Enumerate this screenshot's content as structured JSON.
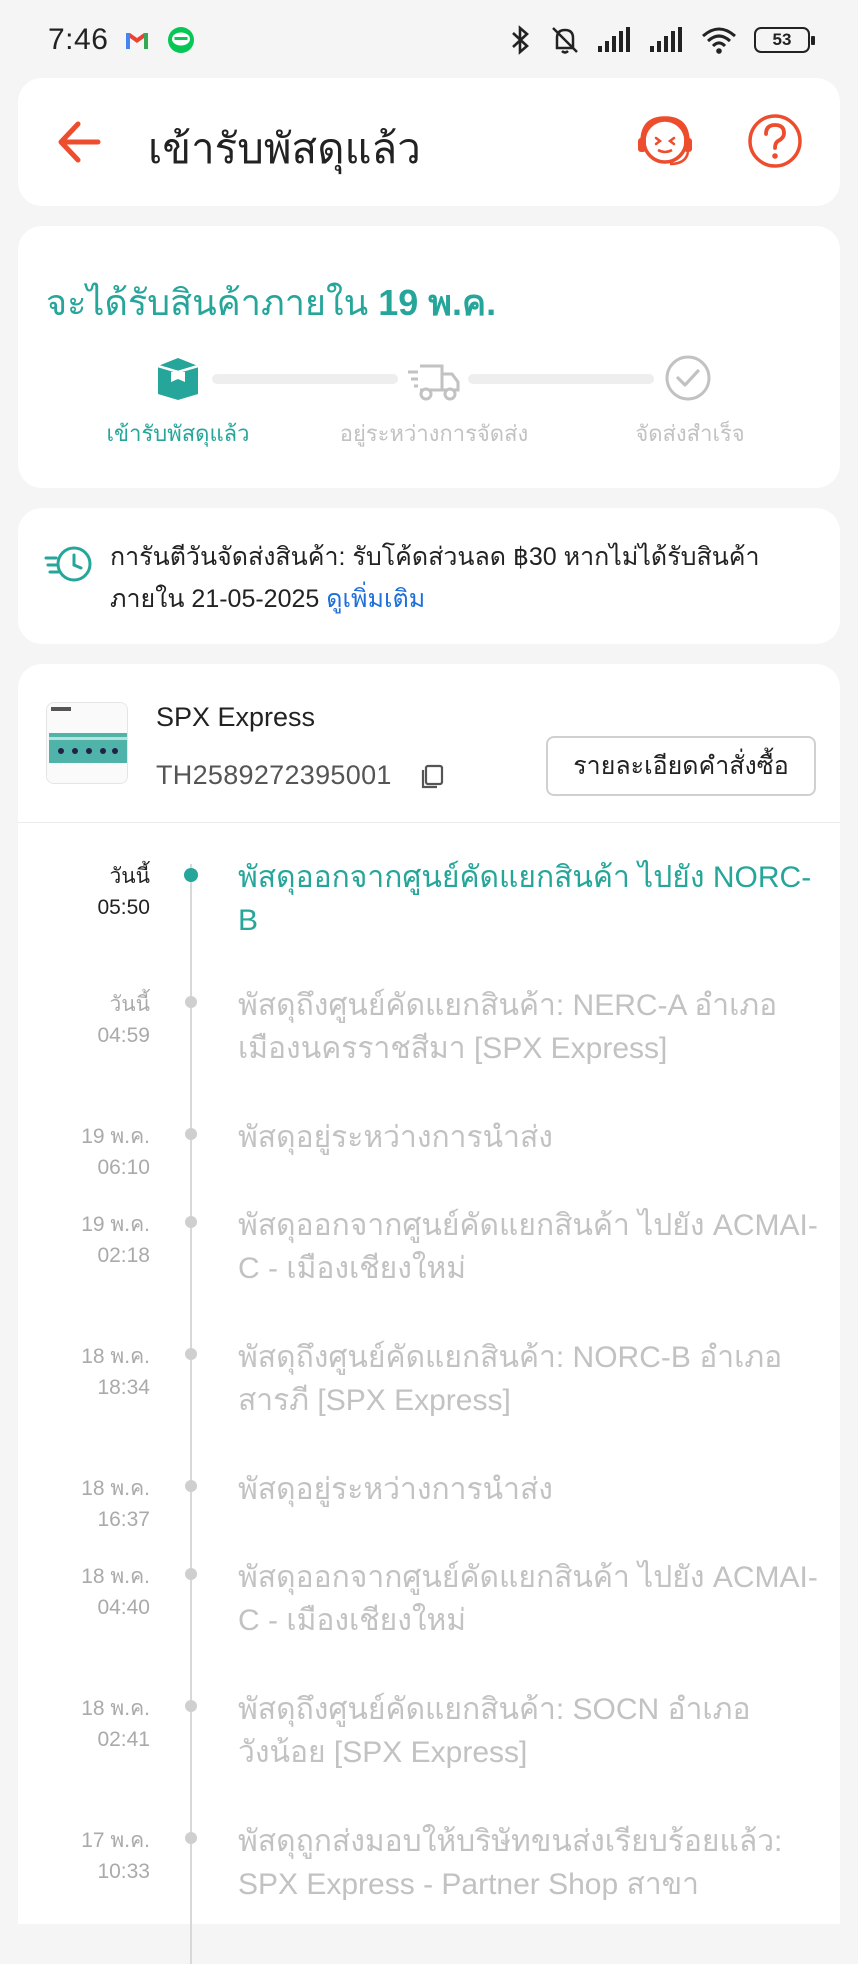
{
  "status_bar": {
    "time": "7:46",
    "battery": "53"
  },
  "header": {
    "title": "เข้ารับพัสดุแล้ว"
  },
  "eta": {
    "prefix": "จะได้รับสินค้าภายใน",
    "date": "19 พ.ค.",
    "steps": [
      {
        "label": "เข้ารับพัสดุแล้ว",
        "active": true
      },
      {
        "label": "อยู่ระหว่างการจัดส่ง",
        "active": false
      },
      {
        "label": "จัดส่งสำเร็จ",
        "active": false
      }
    ],
    "active_color": "#26a69a",
    "inactive_color": "#c2c2c2"
  },
  "guarantee": {
    "text": "การันตีวันจัดส่งสินค้า: รับโค้ดส่วนลด ฿30 หากไม่ได้รับสินค้าภายใน 21-05-2025",
    "link": "ดูเพิ่มเติม"
  },
  "shipment": {
    "carrier": "SPX Express",
    "tracking_number": "TH2589272395001",
    "order_detail_button": "รายละเอียดคำสั่งซื้อ"
  },
  "timeline": [
    {
      "date": "วันนี้",
      "time": "05:50",
      "description": "พัสดุออกจากศูนย์คัดแยกสินค้า ไปยัง NORC-B",
      "current": true
    },
    {
      "date": "วันนี้",
      "time": "04:59",
      "description": "พัสดุถึงศูนย์คัดแยกสินค้า: NERC-A อำเภอเมืองนครราชสีมา [SPX Express]",
      "current": false
    },
    {
      "date": "19 พ.ค.",
      "time": "06:10",
      "description": "พัสดุอยู่ระหว่างการนำส่ง",
      "current": false
    },
    {
      "date": "19 พ.ค.",
      "time": "02:18",
      "description": "พัสดุออกจากศูนย์คัดแยกสินค้า ไปยัง ACMAI-C - เมืองเชียงใหม่",
      "current": false
    },
    {
      "date": "18 พ.ค.",
      "time": "18:34",
      "description": "พัสดุถึงศูนย์คัดแยกสินค้า: NORC-B อำเภอสารภี [SPX Express]",
      "current": false
    },
    {
      "date": "18 พ.ค.",
      "time": "16:37",
      "description": "พัสดุอยู่ระหว่างการนำส่ง",
      "current": false
    },
    {
      "date": "18 พ.ค.",
      "time": "04:40",
      "description": "พัสดุออกจากศูนย์คัดแยกสินค้า ไปยัง ACMAI-C - เมืองเชียงใหม่",
      "current": false
    },
    {
      "date": "18 พ.ค.",
      "time": "02:41",
      "description": "พัสดุถึงศูนย์คัดแยกสินค้า: SOCN อำเภอวังน้อย [SPX Express]",
      "current": false
    },
    {
      "date": "17 พ.ค.",
      "time": "10:33",
      "description": "พัสดุถูกส่งมอบให้บริษัทขนส่งเรียบร้อยแล้ว: SPX Express - Partner Shop สาขา",
      "current": false
    }
  ],
  "colors": {
    "accent": "#26a69a",
    "header_icon": "#ee4d2d",
    "link": "#1e6fd9"
  },
  "icons": [
    "back-arrow-icon",
    "support-agent-icon",
    "help-icon",
    "package-icon",
    "truck-icon",
    "check-circle-icon",
    "clock-fast-icon",
    "copy-icon"
  ]
}
